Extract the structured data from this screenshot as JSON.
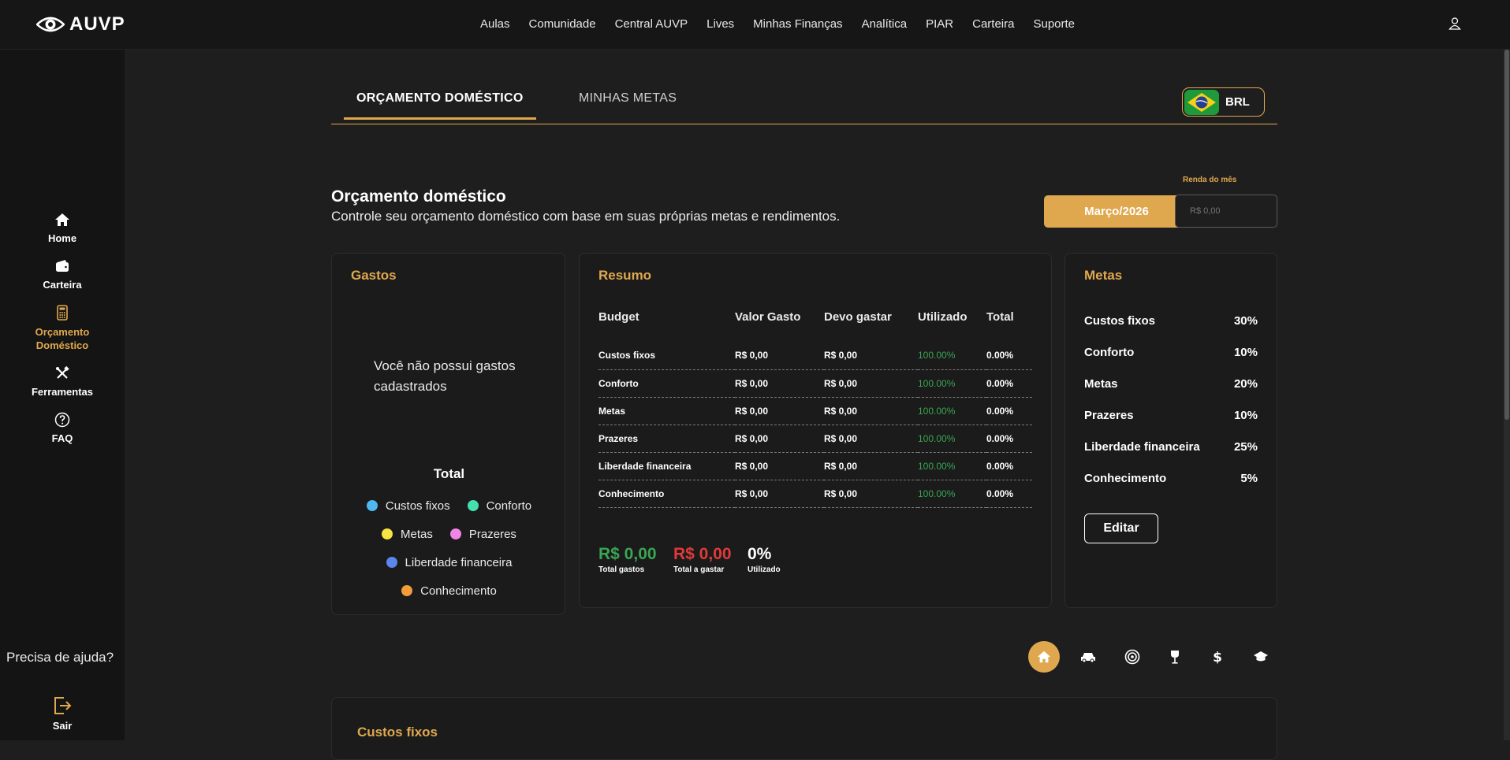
{
  "brand": {
    "name": "AUVP"
  },
  "nav": [
    "Aulas",
    "Comunidade",
    "Central AUVP",
    "Lives",
    "Minhas Finanças",
    "Analítica",
    "PIAR",
    "Carteira",
    "Suporte"
  ],
  "sidebar": {
    "items": [
      {
        "label": "Home",
        "icon": "home-icon"
      },
      {
        "label": "Carteira",
        "icon": "wallet-icon"
      },
      {
        "label": "Orçamento Doméstico",
        "icon": "calculator-icon",
        "active": true
      },
      {
        "label": "Ferramentas",
        "icon": "tools-icon"
      },
      {
        "label": "FAQ",
        "icon": "question-icon"
      }
    ],
    "help": "Precisa de ajuda?",
    "logout": "Sair"
  },
  "tabs": [
    "ORÇAMENTO DOMÉSTICO",
    "MINHAS METAS"
  ],
  "currency": "BRL",
  "header": {
    "title": "Orçamento doméstico",
    "subtitle": "Controle seu orçamento doméstico com base em suas próprias metas e rendimentos.",
    "month": "Março/2026",
    "income_label": "Renda do mês",
    "income_placeholder": "R$ 0,00"
  },
  "gastos": {
    "title": "Gastos",
    "empty": "Você não possui gastos cadastrados",
    "total": "Total",
    "legend": [
      {
        "label": "Custos fixos",
        "color": "#4fb8f0"
      },
      {
        "label": "Conforto",
        "color": "#45e0b0"
      },
      {
        "label": "Metas",
        "color": "#f5e642"
      },
      {
        "label": "Prazeres",
        "color": "#ef86e6"
      },
      {
        "label": "Liberdade financeira",
        "color": "#5b86ee"
      },
      {
        "label": "Conhecimento",
        "color": "#f59b3a"
      }
    ]
  },
  "resumo": {
    "title": "Resumo",
    "columns": [
      "Budget",
      "Valor Gasto",
      "Devo gastar",
      "Utilizado",
      "Total"
    ],
    "rows": [
      [
        "Custos fixos",
        "R$ 0,00",
        "R$ 0,00",
        "100.00%",
        "0.00%"
      ],
      [
        "Conforto",
        "R$ 0,00",
        "R$ 0,00",
        "100.00%",
        "0.00%"
      ],
      [
        "Metas",
        "R$ 0,00",
        "R$ 0,00",
        "100.00%",
        "0.00%"
      ],
      [
        "Prazeres",
        "R$ 0,00",
        "R$ 0,00",
        "100.00%",
        "0.00%"
      ],
      [
        "Liberdade financeira",
        "R$ 0,00",
        "R$ 0,00",
        "100.00%",
        "0.00%"
      ],
      [
        "Conhecimento",
        "R$ 0,00",
        "R$ 0,00",
        "100.00%",
        "0.00%"
      ]
    ],
    "totals": [
      {
        "value": "R$ 0,00",
        "label": "Total gastos",
        "color": "#3aa552"
      },
      {
        "value": "R$ 0,00",
        "label": "Total a gastar",
        "color": "#e03a3a"
      },
      {
        "value": "0%",
        "label": "Utilizado",
        "color": "#ffffff"
      }
    ]
  },
  "metas": {
    "title": "Metas",
    "items": [
      {
        "label": "Custos fixos",
        "value": "30%"
      },
      {
        "label": "Conforto",
        "value": "10%"
      },
      {
        "label": "Metas",
        "value": "20%"
      },
      {
        "label": "Prazeres",
        "value": "10%"
      },
      {
        "label": "Liberdade financeira",
        "value": "25%"
      },
      {
        "label": "Conhecimento",
        "value": "5%"
      }
    ],
    "edit": "Editar"
  },
  "category_icons": [
    "home-icon",
    "car-icon",
    "target-icon",
    "wine-icon",
    "dollar-icon",
    "graduation-cap-icon"
  ],
  "section": {
    "title": "Custos fixos"
  }
}
